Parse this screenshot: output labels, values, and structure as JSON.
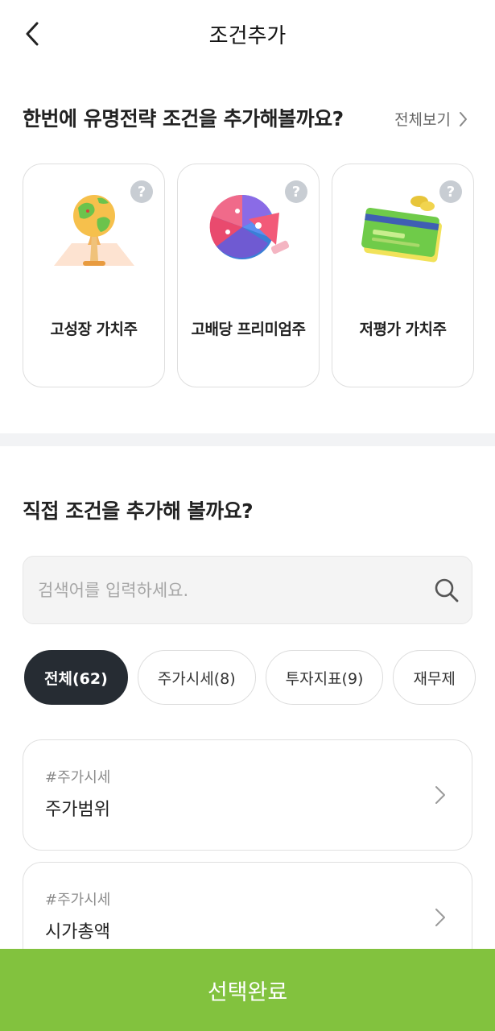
{
  "header": {
    "title": "조건추가"
  },
  "famous": {
    "title": "한번에 유명전략 조건을 추가해볼까요?",
    "view_all": "전체보기",
    "cards": [
      {
        "label": "고성장 가치주",
        "icon": "globe-icon"
      },
      {
        "label": "고배당 프리미엄주",
        "icon": "pie-chart-icon"
      },
      {
        "label": "저평가 가치주",
        "icon": "credit-card-icon"
      }
    ],
    "help_symbol": "?"
  },
  "direct": {
    "title": "직접 조건을 추가해 볼까요?",
    "search_placeholder": "검색어를 입력하세요.",
    "chips": [
      {
        "label": "전체(62)",
        "active": true
      },
      {
        "label": "주가시세(8)",
        "active": false
      },
      {
        "label": "투자지표(9)",
        "active": false
      },
      {
        "label": "재무제",
        "active": false
      }
    ],
    "items": [
      {
        "tag": "#주가시세",
        "name": "주가범위"
      },
      {
        "tag": "#주가시세",
        "name": "시가총액"
      }
    ]
  },
  "footer": {
    "confirm_label": "선택완료"
  },
  "colors": {
    "accent": "#82c23e",
    "chip_active": "#262c33",
    "divider": "#f2f3f5"
  }
}
